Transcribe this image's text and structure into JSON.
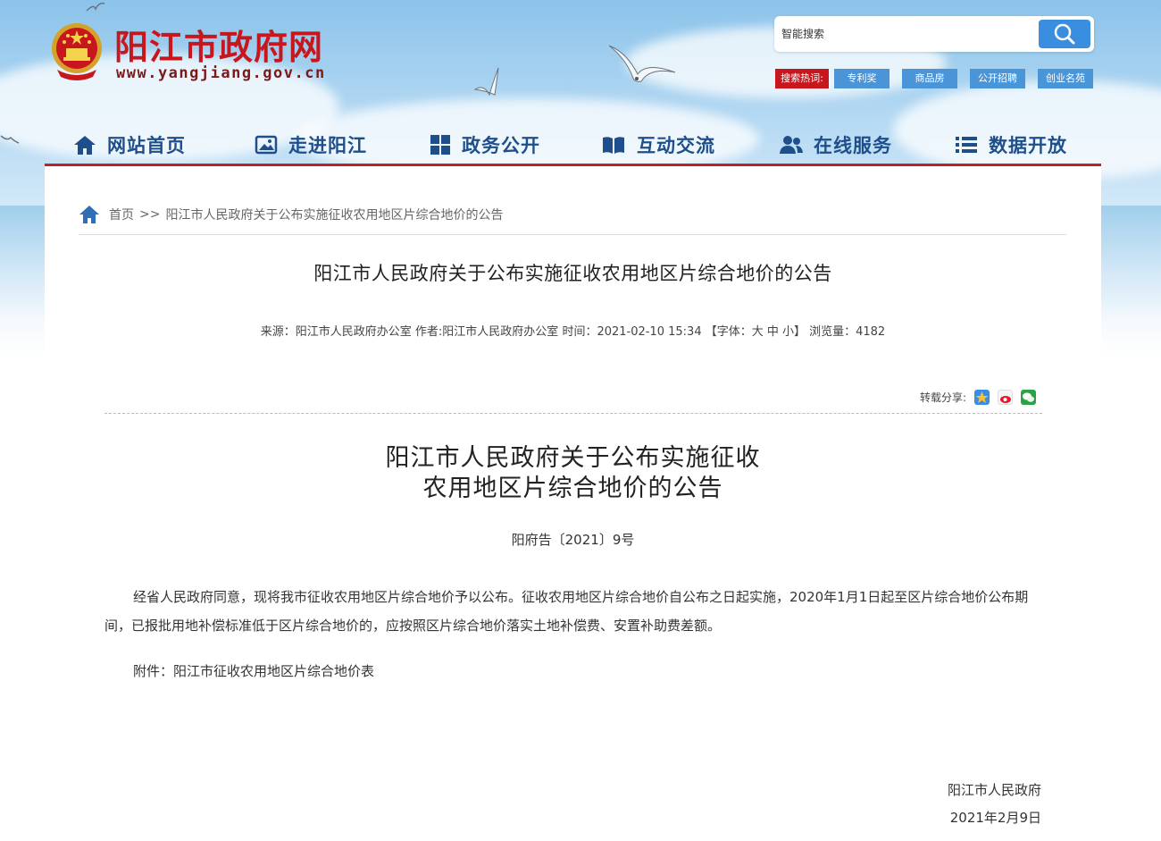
{
  "header": {
    "site_title": "阳江市政府网",
    "site_url": "www.yangjiang.gov.cn",
    "search_placeholder": "智能搜索",
    "hot_label": "搜索热词:",
    "hot_tags": [
      "专利奖",
      "商品房",
      "公开招聘",
      "创业名苑"
    ]
  },
  "nav": {
    "items": [
      {
        "label": "网站首页",
        "icon": "home-icon"
      },
      {
        "label": "走进阳江",
        "icon": "picture-icon"
      },
      {
        "label": "政务公开",
        "icon": "grid-icon"
      },
      {
        "label": "互动交流",
        "icon": "book-icon"
      },
      {
        "label": "在线服务",
        "icon": "users-icon"
      },
      {
        "label": "数据开放",
        "icon": "list-icon"
      }
    ]
  },
  "breadcrumb": {
    "home": "首页",
    "separator": ">>",
    "current": "阳江市人民政府关于公布实施征收农用地区片综合地价的公告"
  },
  "article": {
    "title": "阳江市人民政府关于公布实施征收农用地区片综合地价的公告",
    "meta": "来源：阳江市人民政府办公室 作者:阳江市人民政府办公室 时间：2021-02-10 15:34 【字体：大 中 小】 浏览量：4182",
    "share_label": "转载分享:",
    "doc_title_line1": "阳江市人民政府关于公布实施征收",
    "doc_title_line2": "农用地区片综合地价的公告",
    "doc_number": "阳府告〔2021〕9号",
    "paragraph1": "经省人民政府同意，现将我市征收农用地区片综合地价予以公布。征收农用地区片综合地价自公布之日起实施，2020年1月1日起至区片综合地价公布期间，已报批用地补偿标准低于区片综合地价的，应按照区片综合地价落实土地补偿费、安置补助费差额。",
    "attachment": "附件：阳江市征收农用地区片综合地价表",
    "signature_org": "阳江市人民政府",
    "signature_date": "2021年2月9日"
  },
  "colors": {
    "brand_red": "#c8161d",
    "nav_blue": "#1f4f8a",
    "search_blue": "#3a8ee0",
    "tag_blue": "#4a95d8"
  }
}
